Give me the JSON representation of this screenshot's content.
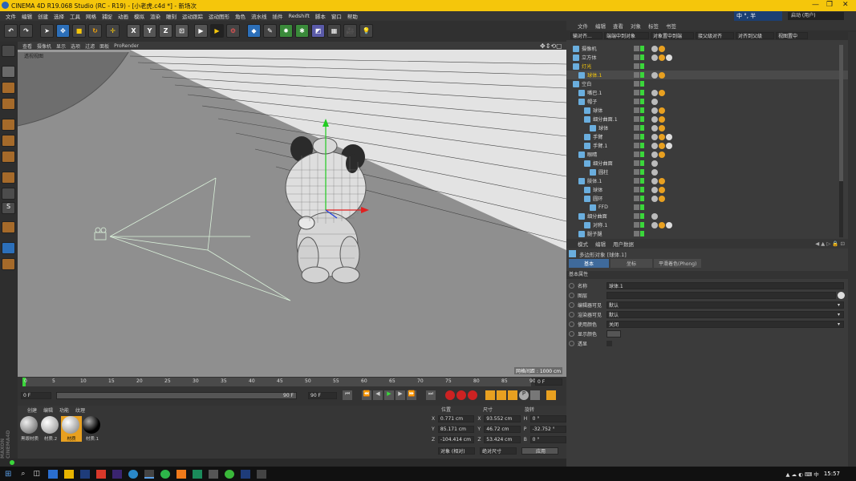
{
  "window": {
    "title": "CINEMA 4D R19.068 Studio (RC - R19) - [小老虎.c4d *] - 新场次"
  },
  "menu": [
    "文件",
    "编辑",
    "创建",
    "选择",
    "工具",
    "网格",
    "捕捉",
    "动画",
    "模拟",
    "渲染",
    "雕刻",
    "运动跟踪",
    "运动图形",
    "角色",
    "流水线",
    "插件",
    "Redshift",
    "脚本",
    "窗口",
    "帮助"
  ],
  "ime": {
    "text": "中 °, 半"
  },
  "layout": {
    "label": "启动 (用户)"
  },
  "viewport": {
    "menus": [
      "查看",
      "摄像机",
      "显示",
      "选项",
      "过滤",
      "面板",
      "ProRender"
    ],
    "camera_label": "透视视图",
    "grid": "网格间距 : 1000 cm"
  },
  "timeline": {
    "ticks": [
      "0",
      "5",
      "10",
      "15",
      "20",
      "25",
      "30",
      "35",
      "40",
      "45",
      "50",
      "55",
      "60",
      "65",
      "70",
      "75",
      "80",
      "85",
      "90"
    ],
    "frame_end": "0 F",
    "start": "0 F",
    "current": "0 F",
    "end_field": "90 F",
    "max": "90 F",
    "scroll_label": "90 F"
  },
  "materials": {
    "menu": [
      "创建",
      "编辑",
      "功能",
      "纹理"
    ],
    "items": [
      {
        "label": "黑眼材质"
      },
      {
        "label": "材质.2"
      },
      {
        "label": "材质"
      },
      {
        "label": "材质.1"
      }
    ]
  },
  "coords": {
    "headers": [
      "位置",
      "尺寸",
      "旋转"
    ],
    "rows": [
      {
        "a": "X",
        "pos": "0.771 cm",
        "b": "X",
        "size": "93.552 cm",
        "c": "H",
        "rot": "0 °"
      },
      {
        "a": "Y",
        "pos": "85.171 cm",
        "b": "Y",
        "size": "46.72 cm",
        "c": "P",
        "rot": "-32.752 °"
      },
      {
        "a": "Z",
        "pos": "-104.414 cm",
        "b": "Z",
        "size": "53.424 cm",
        "c": "B",
        "rot": "0 °"
      }
    ],
    "mode": "对象 (相对)",
    "size_mode": "绝对尺寸",
    "apply": "应用"
  },
  "objmgr": {
    "menu": [
      "文件",
      "编辑",
      "查看",
      "对象",
      "标签",
      "书签"
    ],
    "toolbar": [
      "输对齐...",
      "端端中到对象",
      "对象置中到端",
      "接父级对齐",
      "对齐到父级",
      "视图置中"
    ],
    "items": [
      {
        "name": "摄像机",
        "indent": 0
      },
      {
        "name": "立方体",
        "indent": 0
      },
      {
        "name": "灯光",
        "indent": 0
      },
      {
        "name": "球体.1",
        "indent": 1
      },
      {
        "name": "空白",
        "indent": 0
      },
      {
        "name": "嘴巴.1",
        "indent": 1
      },
      {
        "name": "帽子",
        "indent": 1
      },
      {
        "name": "球体",
        "indent": 2
      },
      {
        "name": "细分曲面.1",
        "indent": 2
      },
      {
        "name": "球体",
        "indent": 3
      },
      {
        "name": "手臂",
        "indent": 2
      },
      {
        "name": "手臂.1",
        "indent": 2
      },
      {
        "name": "眼睛",
        "indent": 1
      },
      {
        "name": "细分曲面",
        "indent": 2
      },
      {
        "name": "圆柱",
        "indent": 3
      },
      {
        "name": "肢体.1",
        "indent": 1
      },
      {
        "name": "球体",
        "indent": 2
      },
      {
        "name": "圆环",
        "indent": 2
      },
      {
        "name": "FFD",
        "indent": 3
      },
      {
        "name": "细分曲面",
        "indent": 1
      },
      {
        "name": "对称.1",
        "indent": 2
      },
      {
        "name": "腿子腿",
        "indent": 1
      }
    ]
  },
  "attr": {
    "menu": [
      "模式",
      "编辑",
      "用户数据"
    ],
    "title": "多边形对象 [球体.1]",
    "tabs": [
      "基本",
      "坐标",
      "平滑着色(Phong)"
    ],
    "section": "基本属性",
    "fields": [
      {
        "label": "名称",
        "value": "球体.1"
      },
      {
        "label": "图层",
        "value": ""
      },
      {
        "label": "编辑器可见",
        "value": "默认"
      },
      {
        "label": "渲染器可见",
        "value": "默认"
      },
      {
        "label": "使用颜色",
        "value": "关闭"
      },
      {
        "label": "显示颜色",
        "value": ""
      },
      {
        "label": "透显",
        "value": ""
      }
    ]
  },
  "taskbar": {
    "time": "15:57"
  },
  "colors": {
    "accent": "#f5c60b",
    "viewport": "#8f8f8f",
    "select": "#3f6a9b"
  }
}
